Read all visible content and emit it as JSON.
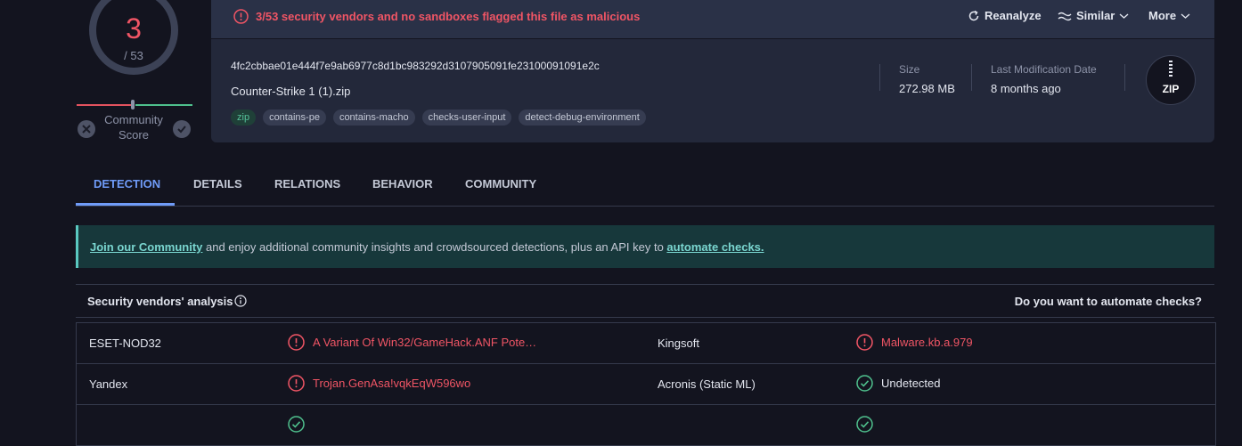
{
  "score": {
    "detections": "3",
    "total": "/ 53",
    "community_label": "Community\nScore"
  },
  "alert": {
    "text": "3/53 security vendors and no sandboxes flagged this file as malicious",
    "reanalyze": "Reanalyze",
    "similar": "Similar",
    "more": "More"
  },
  "file": {
    "hash": "4fc2cbbae01e444f7e9ab6977c8d1bc983292d3107905091fe23100091091e2c",
    "name": "Counter-Strike 1 (1).zip",
    "tags": [
      "zip",
      "contains-pe",
      "contains-macho",
      "checks-user-input",
      "detect-debug-environment"
    ],
    "size_label": "Size",
    "size_value": "272.98 MB",
    "modified_label": "Last Modification Date",
    "modified_value": "8 months ago",
    "type_badge": "ZIP"
  },
  "tabs": [
    "DETECTION",
    "DETAILS",
    "RELATIONS",
    "BEHAVIOR",
    "COMMUNITY"
  ],
  "banner": {
    "link1": "Join our Community",
    "mid": " and enjoy additional community insights and crowdsourced detections, plus an API key to ",
    "link2": "automate checks."
  },
  "analysis": {
    "title": "Security vendors' analysis",
    "automate": "Do you want to automate checks?",
    "rows": [
      {
        "v1": "ESET-NOD32",
        "r1": "A Variant Of Win32/GameHack.ANF Pote…",
        "s1": "malicious",
        "v2": "Kingsoft",
        "r2": "Malware.kb.a.979",
        "s2": "malicious"
      },
      {
        "v1": "Yandex",
        "r1": "Trojan.GenAsa!vqkEqW596wo",
        "s1": "malicious",
        "v2": "Acronis (Static ML)",
        "r2": "Undetected",
        "s2": "undetected"
      },
      {
        "v1": "",
        "r1": "",
        "s1": "undetected",
        "v2": "",
        "r2": "",
        "s2": "undetected"
      }
    ]
  },
  "colors": {
    "malicious": "#f05565",
    "undetected": "#4fc08d",
    "accent": "#6f9bf7"
  }
}
